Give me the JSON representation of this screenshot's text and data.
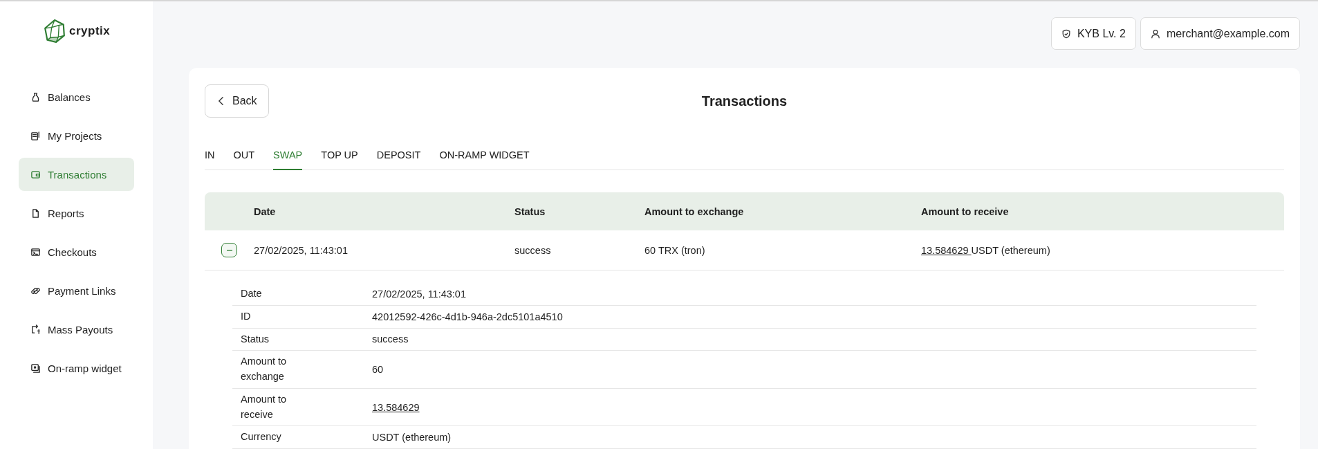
{
  "brand": {
    "name": "cryptix"
  },
  "sidebar": {
    "items": [
      {
        "label": "Balances",
        "selected": false
      },
      {
        "label": "My Projects",
        "selected": false
      },
      {
        "label": "Transactions",
        "selected": true
      },
      {
        "label": "Reports",
        "selected": false
      },
      {
        "label": "Checkouts",
        "selected": false
      },
      {
        "label": "Payment Links",
        "selected": false
      },
      {
        "label": "Mass Payouts",
        "selected": false
      },
      {
        "label": "On-ramp widget",
        "selected": false
      }
    ]
  },
  "header": {
    "kyb": "KYB Lv. 2",
    "user": "merchant@example.com"
  },
  "page": {
    "back": "Back",
    "title": "Transactions"
  },
  "tabs": [
    {
      "label": "IN",
      "selected": false
    },
    {
      "label": "OUT",
      "selected": false
    },
    {
      "label": "SWAP",
      "selected": true
    },
    {
      "label": "TOP UP",
      "selected": false
    },
    {
      "label": "DEPOSIT",
      "selected": false
    },
    {
      "label": "ON-RAMP WIDGET",
      "selected": false
    }
  ],
  "table": {
    "columns": [
      "Date",
      "Status",
      "Amount to exchange",
      "Amount to receive"
    ],
    "rows": [
      {
        "expanded": true,
        "date": "27/02/2025, 11:43:01",
        "status": "success",
        "amount_to_exchange": "60 TRX (tron)",
        "amount_to_receive": {
          "link": "13.584629",
          "rest": "USDT (ethereum)"
        },
        "details": [
          {
            "label": "Date",
            "value": "27/02/2025, 11:43:01",
            "kind": "text"
          },
          {
            "label": "ID",
            "value": "42012592-426c-4d1b-946a-2dc5101a4510",
            "kind": "text"
          },
          {
            "label": "Status",
            "value": "success",
            "kind": "text"
          },
          {
            "label": "Amount to exchange",
            "value": "60",
            "kind": "text"
          },
          {
            "label": "Amount to receive",
            "value": "13.584629",
            "kind": "link"
          },
          {
            "label": "Currency",
            "value": "USDT (ethereum)",
            "kind": "text"
          }
        ]
      }
    ]
  }
}
